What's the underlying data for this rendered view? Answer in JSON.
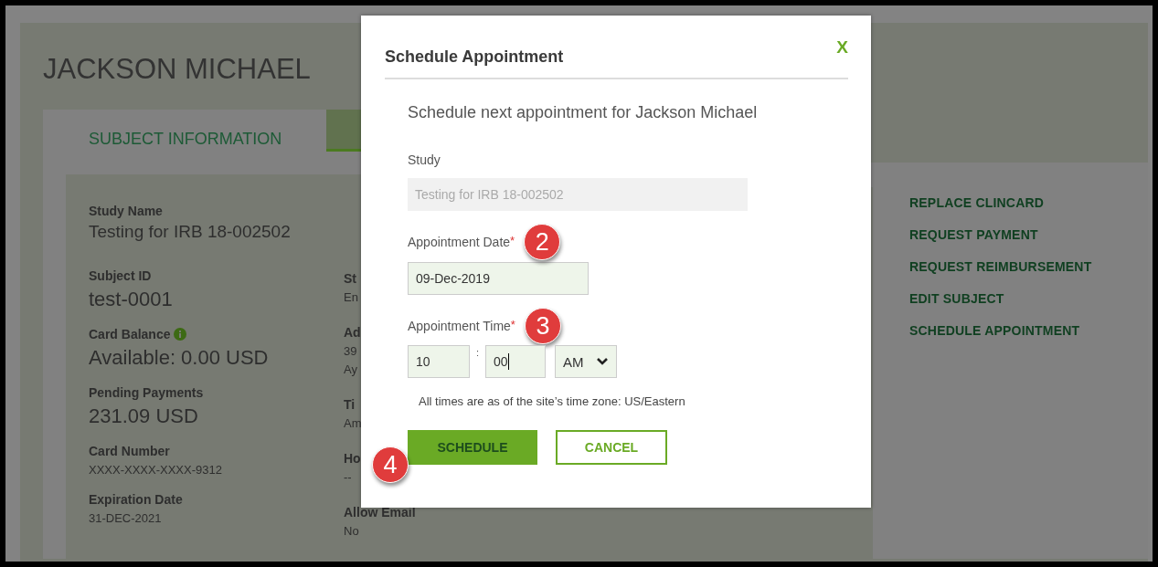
{
  "page": {
    "title": "JACKSON MICHAEL",
    "tabs": [
      {
        "label": "SUBJECT INFORMATION",
        "selected": false
      },
      {
        "selected": true
      }
    ],
    "details_column_1": [
      {
        "label": "Study Name",
        "value": "Testing for IRB 18-002502",
        "kind": "medium"
      },
      {
        "label": "Subject ID",
        "value": "test-0001",
        "kind": "large"
      },
      {
        "label": "Card Balance",
        "info": true,
        "value": "Available: 0.00 USD",
        "kind": "large"
      },
      {
        "label": "Pending Payments",
        "value": "231.09 USD",
        "kind": "large"
      },
      {
        "label": "Card Number",
        "value": "XXXX-XXXX-XXXX-9312",
        "kind": "small"
      },
      {
        "label": "Expiration Date",
        "value": "31-DEC-2021",
        "kind": "small"
      }
    ],
    "details_column_2": [
      {
        "label": "St",
        "lines": [
          "En"
        ]
      },
      {
        "label": "Ad",
        "lines": [
          "39",
          "Ay"
        ]
      },
      {
        "label": "Ti",
        "lines": [
          "Am"
        ]
      },
      {
        "label": "Ho",
        "lines": [
          "--"
        ]
      },
      {
        "label": "Allow Email",
        "lines": [
          "No"
        ]
      }
    ],
    "actions": [
      "REPLACE CLINCARD",
      "REQUEST PAYMENT",
      "REQUEST REIMBURSEMENT",
      "EDIT SUBJECT",
      "SCHEDULE APPOINTMENT"
    ]
  },
  "modal": {
    "title": "Schedule Appointment",
    "close": "X",
    "subtitle": "Schedule next appointment for Jackson Michael",
    "study": {
      "label": "Study",
      "value": "Testing for IRB 18-002502",
      "disabled": true
    },
    "date": {
      "label": "Appointment Date",
      "required_mark": "*",
      "value": "09-Dec-2019"
    },
    "time": {
      "label": "Appointment Time",
      "required_mark": "*",
      "hour": "10",
      "separator": ":",
      "minute": "00",
      "minute_focused": true,
      "period": "AM"
    },
    "note": "All times are as of the site’s time zone: US/Eastern",
    "buttons": [
      {
        "label": "SCHEDULE",
        "kind": "primary"
      },
      {
        "label": "CANCEL",
        "kind": "secondary"
      }
    ]
  },
  "step_markers": [
    {
      "label": "2"
    },
    {
      "label": "3"
    },
    {
      "label": "4"
    }
  ]
}
